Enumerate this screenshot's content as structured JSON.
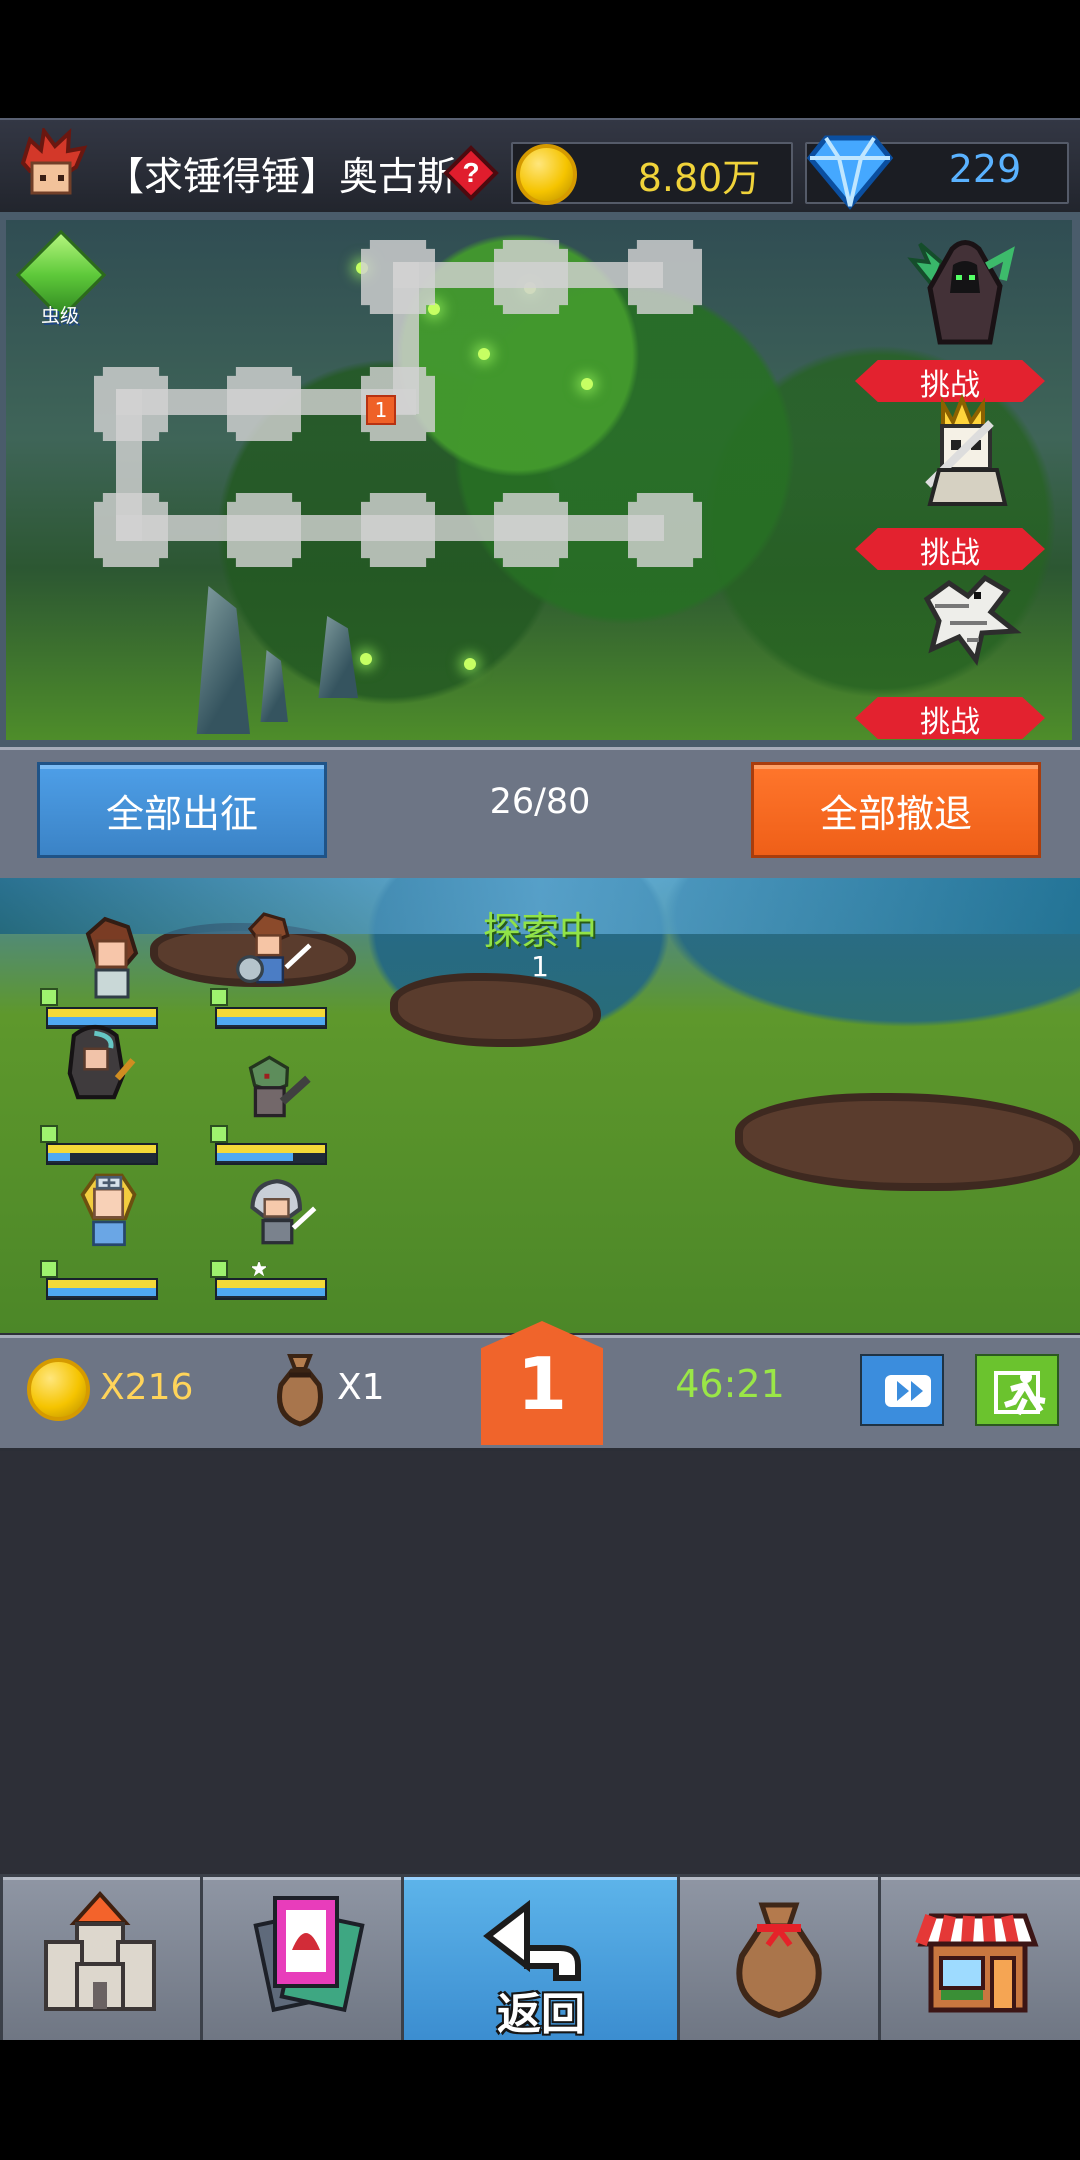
{
  "player": {
    "name": "【求锤得锤】奥古斯",
    "gold": "8.80万",
    "diamonds": "229"
  },
  "map": {
    "grade_label": "虫级",
    "current_room": "1",
    "challenge_labels": [
      "挑战",
      "挑战",
      "挑战"
    ]
  },
  "controls": {
    "deploy_all": "全部出征",
    "progress": "26/80",
    "retreat_all": "全部撤退"
  },
  "battle": {
    "status": "探索中",
    "status_value": "1"
  },
  "rewards": {
    "gold_count": "X216",
    "bag_count": "X1",
    "level": "1",
    "timer": "46:21"
  },
  "navigation": {
    "back_label": "返回"
  },
  "colors": {
    "accent_blue": "#4e9fe8",
    "accent_orange": "#f0642b",
    "gold_text": "#ffd45a",
    "green_text": "#91e347"
  }
}
